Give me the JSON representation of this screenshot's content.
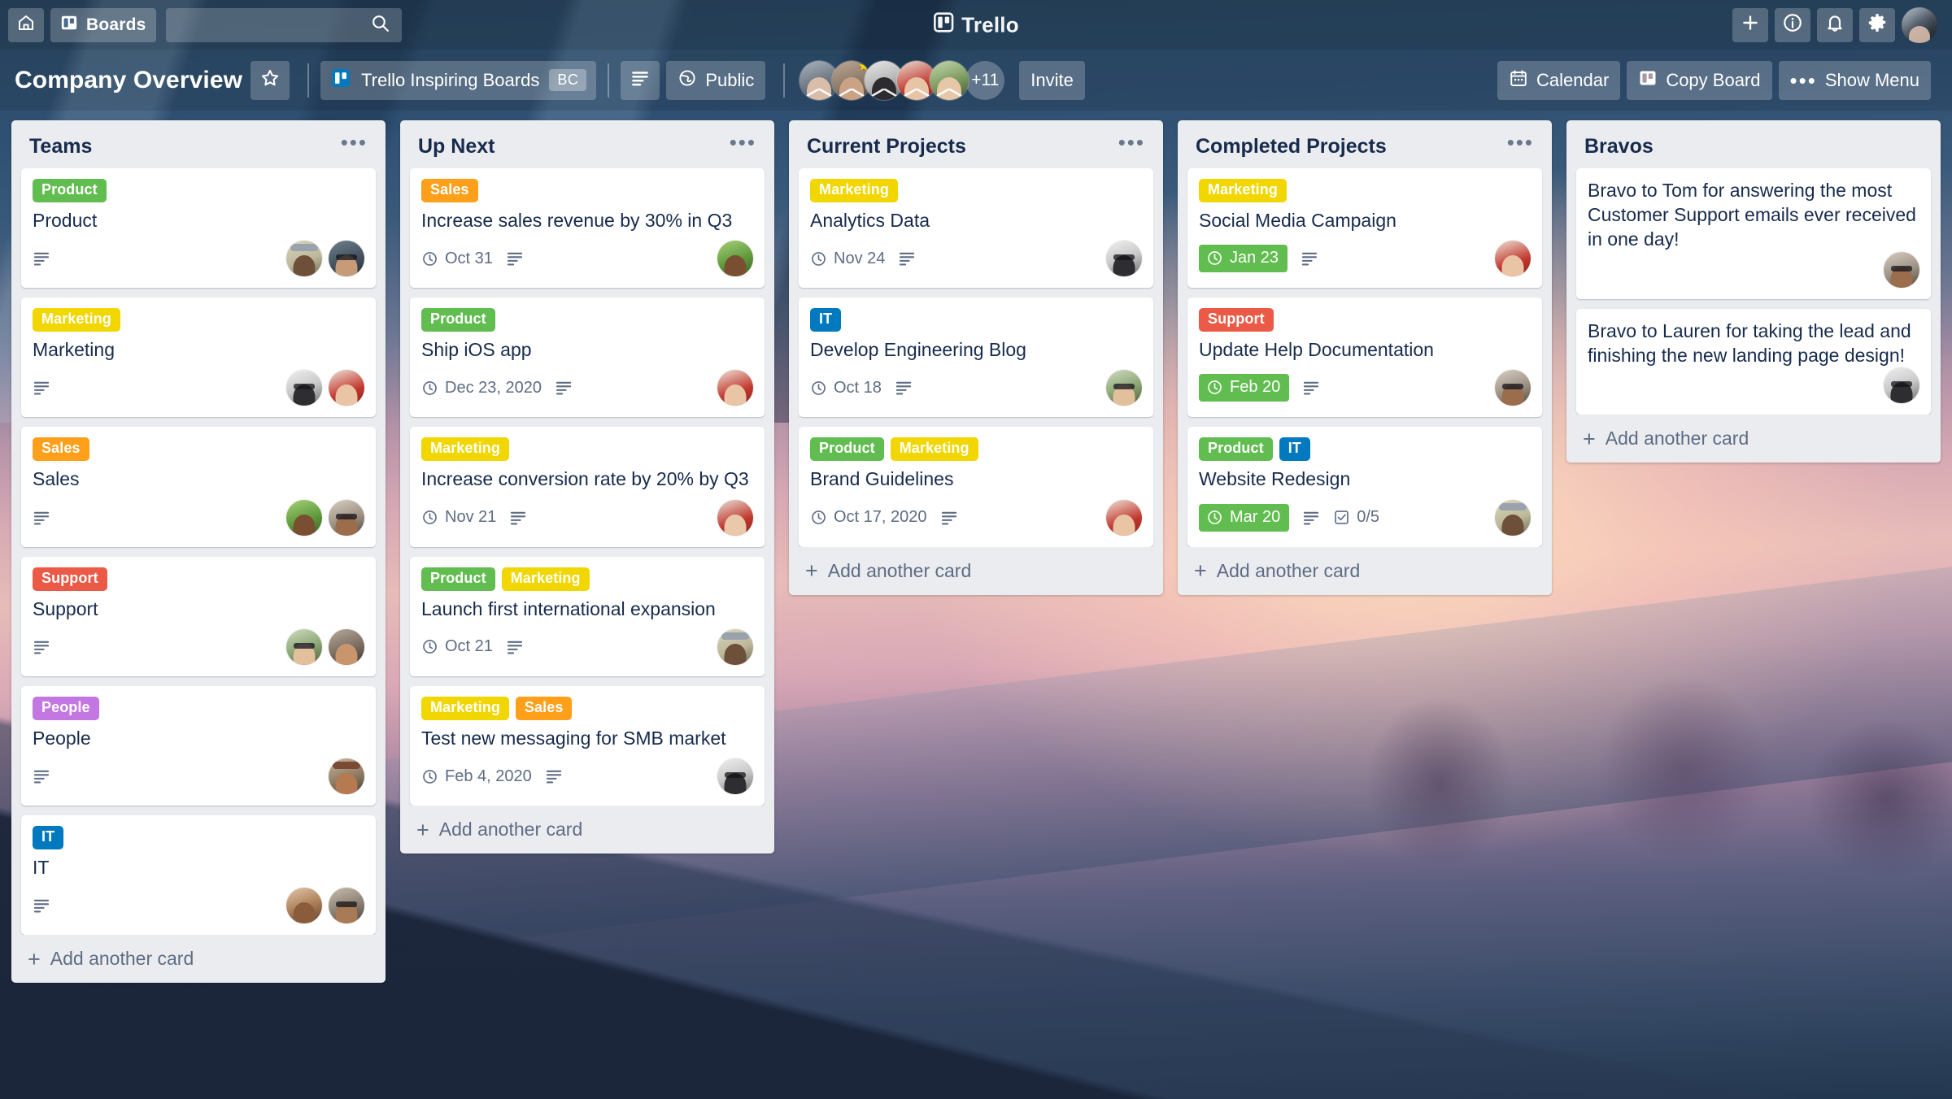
{
  "topbar": {
    "home_icon": "home-icon",
    "boards_label": "Boards",
    "boards_icon": "board-icon",
    "search_icon": "search-icon",
    "search_placeholder": "",
    "logo_text": "Trello",
    "add_icon": "plus-icon",
    "info_icon": "info-icon",
    "notifications_icon": "bell-icon",
    "settings_icon": "gear-icon",
    "account_avatar": "user-avatar"
  },
  "boardbar": {
    "title": "Company Overview",
    "star_icon": "star-icon",
    "team_name": "Trello Inspiring Boards",
    "team_initials": "BC",
    "team_logo_icon": "trello-logo-icon",
    "view_icon": "list-view-icon",
    "visibility_label": "Public",
    "visibility_icon": "globe-icon",
    "members_more": "+11",
    "invite_label": "Invite",
    "calendar_label": "Calendar",
    "calendar_icon": "calendar-icon",
    "copy_board_label": "Copy Board",
    "copy_board_icon": "board-icon",
    "show_menu_label": "Show Menu",
    "show_menu_icon": "ellipsis-icon"
  },
  "colors": {
    "label_product": "#61bd4f",
    "label_marketing": "#f2d600",
    "label_sales": "#ff9f1a",
    "label_support": "#eb5a46",
    "label_people": "#c377e0",
    "label_it": "#0079bf",
    "due_complete": "#61bd4f",
    "list_bg": "#ebecf0",
    "card_text": "#172b4d"
  },
  "add_card_label": "Add another card",
  "lists": [
    {
      "title": "Teams",
      "menu_icon": "ellipsis-icon",
      "add_card_label": "Add another card",
      "cards": [
        {
          "labels": [
            {
              "text": "Product",
              "cls": "lb-product"
            }
          ],
          "title": "Product",
          "has_desc": true,
          "avatars": [
            "hat-man",
            "sunglasses-woman"
          ]
        },
        {
          "labels": [
            {
              "text": "Marketing",
              "cls": "lb-marketing"
            }
          ],
          "title": "Marketing",
          "has_desc": true,
          "avatars": [
            "bw-woman",
            "red-dress-woman"
          ]
        },
        {
          "labels": [
            {
              "text": "Sales",
              "cls": "lb-sales"
            }
          ],
          "title": "Sales",
          "has_desc": true,
          "avatars": [
            "green-bg-woman",
            "glasses-man"
          ]
        },
        {
          "labels": [
            {
              "text": "Support",
              "cls": "lb-support"
            }
          ],
          "title": "Support",
          "has_desc": true,
          "avatars": [
            "blonde-glasses-woman",
            "dark-hair-man"
          ]
        },
        {
          "labels": [
            {
              "text": "People",
              "cls": "lb-people"
            }
          ],
          "title": "People",
          "has_desc": true,
          "avatars": [
            "cap-man"
          ]
        },
        {
          "labels": [
            {
              "text": "IT",
              "cls": "lb-it"
            }
          ],
          "title": "IT",
          "has_desc": true,
          "avatars": [
            "smiling-woman",
            "beard-man"
          ]
        }
      ]
    },
    {
      "title": "Up Next",
      "menu_icon": "ellipsis-icon",
      "add_card_label": "Add another card",
      "cards": [
        {
          "labels": [
            {
              "text": "Sales",
              "cls": "lb-sales"
            }
          ],
          "title": "Increase sales revenue by 30% in Q3",
          "due": "Oct 31",
          "has_desc": true,
          "avatars": [
            "green-bg-woman"
          ]
        },
        {
          "labels": [
            {
              "text": "Product",
              "cls": "lb-product"
            }
          ],
          "title": "Ship iOS app",
          "due": "Dec 23, 2020",
          "has_desc": true,
          "avatars": [
            "red-dress-woman"
          ]
        },
        {
          "labels": [
            {
              "text": "Marketing",
              "cls": "lb-marketing"
            }
          ],
          "title": "Increase conversion rate by 20% by Q3",
          "due": "Nov 21",
          "has_desc": true,
          "avatars": [
            "red-dress-woman2"
          ]
        },
        {
          "labels": [
            {
              "text": "Product",
              "cls": "lb-product"
            },
            {
              "text": "Marketing",
              "cls": "lb-marketing"
            }
          ],
          "title": "Launch first international expansion",
          "due": "Oct 21",
          "has_desc": true,
          "avatars": [
            "hat-man"
          ]
        },
        {
          "labels": [
            {
              "text": "Marketing",
              "cls": "lb-marketing"
            },
            {
              "text": "Sales",
              "cls": "lb-sales"
            }
          ],
          "title": "Test new messaging for SMB market",
          "due": "Feb 4, 2020",
          "has_desc": true,
          "avatars": [
            "bw-woman"
          ]
        }
      ]
    },
    {
      "title": "Current Projects",
      "menu_icon": "ellipsis-icon",
      "add_card_label": "Add another card",
      "cards": [
        {
          "labels": [
            {
              "text": "Marketing",
              "cls": "lb-marketing"
            }
          ],
          "title": "Analytics Data",
          "due": "Nov 24",
          "has_desc": true,
          "avatars": [
            "bw-woman"
          ]
        },
        {
          "labels": [
            {
              "text": "IT",
              "cls": "lb-it"
            }
          ],
          "title": "Develop Engineering Blog",
          "due": "Oct 18",
          "has_desc": true,
          "avatars": [
            "blonde-glasses-woman"
          ]
        },
        {
          "labels": [
            {
              "text": "Product",
              "cls": "lb-product"
            },
            {
              "text": "Marketing",
              "cls": "lb-marketing"
            }
          ],
          "title": "Brand Guidelines",
          "due": "Oct 17, 2020",
          "has_desc": true,
          "avatars": [
            "red-dress-woman"
          ]
        }
      ]
    },
    {
      "title": "Completed Projects",
      "menu_icon": "ellipsis-icon",
      "add_card_label": "Add another card",
      "cards": [
        {
          "labels": [
            {
              "text": "Marketing",
              "cls": "lb-marketing"
            }
          ],
          "title": "Social Media Campaign",
          "due": "Jan 23",
          "due_complete": true,
          "has_desc": true,
          "avatars": [
            "red-dress-woman"
          ]
        },
        {
          "labels": [
            {
              "text": "Support",
              "cls": "lb-support"
            }
          ],
          "title": "Update Help Documentation",
          "due": "Feb 20",
          "due_complete": true,
          "has_desc": true,
          "avatars": [
            "glasses-man"
          ]
        },
        {
          "labels": [
            {
              "text": "Product",
              "cls": "lb-product"
            },
            {
              "text": "IT",
              "cls": "lb-it"
            }
          ],
          "title": "Website Redesign",
          "due": "Mar 20",
          "due_complete": true,
          "has_desc": true,
          "checklist": "0/5",
          "avatars": [
            "hat-man"
          ]
        }
      ]
    },
    {
      "title": "Bravos",
      "menu_icon": null,
      "add_card_label": "Add another card",
      "cards": [
        {
          "labels": [],
          "title": "Bravo to Tom for answering the most Customer Support emails ever received in one day!",
          "avatars": [
            "glasses-man"
          ]
        },
        {
          "labels": [],
          "title": "Bravo to Lauren for taking the lead and finishing the new landing page design!",
          "avatars": [
            "bw-woman"
          ]
        }
      ]
    }
  ]
}
